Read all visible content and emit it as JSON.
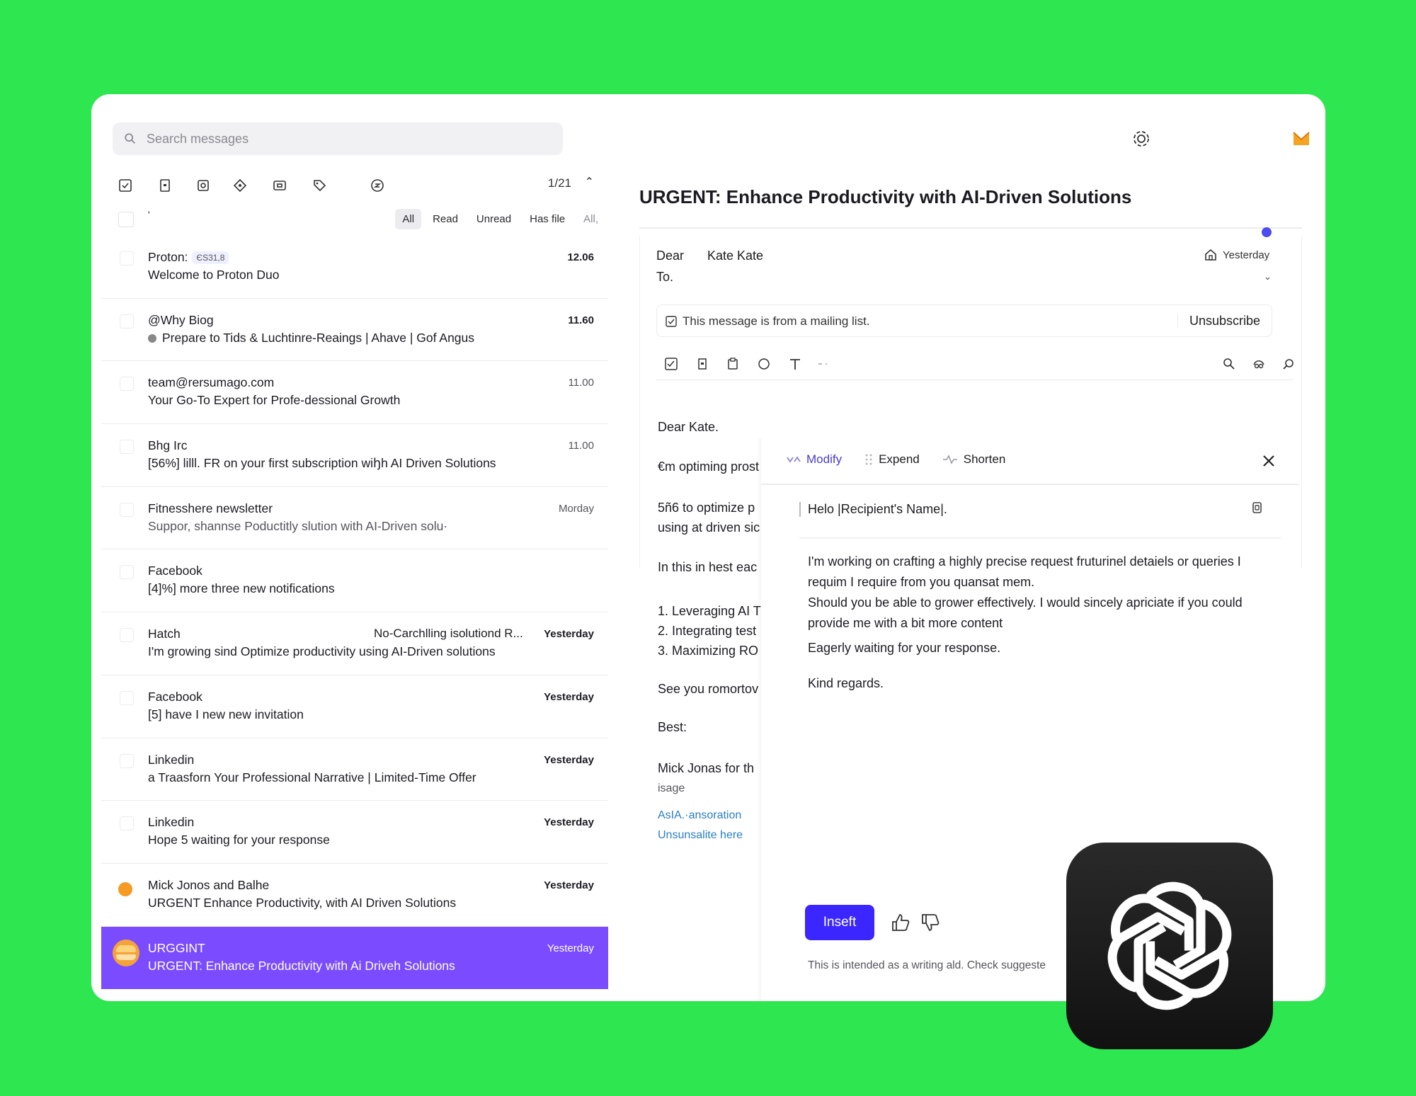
{
  "search": {
    "placeholder": "Search messages"
  },
  "toolbar": {
    "counter": "1/21",
    "chevron": "⌃"
  },
  "filters": {
    "mark": "'",
    "items": [
      "All",
      "Read",
      "Unread",
      "Has file",
      "All,"
    ]
  },
  "emails": [
    {
      "from": "Proton:",
      "tag": "ЄЅ31,8",
      "subject": "Welcome to Proton Duo",
      "time": "12.06"
    },
    {
      "from": "@Why  Biog",
      "subject": "Prepare to  Tids & Luchtinre-Reaings | Ahave | Gof Angus",
      "time": "11.60"
    },
    {
      "from": "team@rersumago.com",
      "subject": "Your Go-To Expert for Profe-dessional Growth",
      "time": "11.00"
    },
    {
      "from": "Bhg   Irc",
      "subject": "[56%] lilll. FR on your first subscription wiꜧh AI Driven Solutions",
      "time": "11.00"
    },
    {
      "from": "Fitnesshere newsletter",
      "subject": "Suppor, shannse Poductitly slution with AI-Driven solu·",
      "time": "Morday"
    },
    {
      "from": "Facebook",
      "subject": "[4]%] more three new notifications",
      "time": ""
    },
    {
      "from": "Hatch",
      "mid": "No-Carchlling isolutiond R...",
      "subject": "I'm growing sind Optimize productivity using AI-Driven solutions",
      "time": "Yesterday"
    },
    {
      "from": "Facebook",
      "subject": "[5] have I new new invitation",
      "time": "Yesterday"
    },
    {
      "from": "Linkedin",
      "subject": "a Traasforn Your Professional Narrative | Limited-Time Offer",
      "time": "Yesterday"
    },
    {
      "from": "Linkedin",
      "subject": "Hope 5 waiting for your response",
      "time": "Yesterday"
    },
    {
      "from": "Mick Jonos and Balhe",
      "subject": "URGENT  Enhance Productivity, with AI Driven Solutions",
      "time": "Yesterday"
    },
    {
      "from": "URGGINT",
      "subject": "URGENT: Enhance Productivity with Ai Driveh Solutions",
      "time": "Yesterday"
    }
  ],
  "message": {
    "title": "URGENT: Enhance Productivity with AI-Driven Solutions",
    "dear_label": "Dear",
    "recipient": "Kate Kate",
    "to_label": "To.",
    "date": "Yesterday",
    "mailing_notice": "This message is from a mailing list.",
    "unsubscribe": "Unsubscribe",
    "body": {
      "greeting": "Dear Kate.",
      "l1": "€m optiming prost",
      "l2": "5ñ6 to optimize p",
      "l3": "using at driven sic",
      "l4": "In this in hest eac",
      "l5": "1. Leveraging AI T",
      "l6": "2. Integrating test",
      "l7": "3. Maximizing RO",
      "l8": "See you romortov",
      "l9": "Best:",
      "l10": "Mick Jonas for th",
      "l11": "isage",
      "link1": "AsIA.·ansoration",
      "link2": "Unsunsalite here"
    }
  },
  "ai": {
    "tabs": [
      "Modify",
      "Expend",
      "Shorten"
    ],
    "greeting": "Helo |Recipient's Name|.",
    "p1": "I'm working on crafting a highly precise request fruturinel detaiels or queries I requim I require from you quansat mem.",
    "p2": "Should you be able to grower effectively. I would sincely apriciate if you could provide me with a bit more content",
    "p3": "Eagerly waiting for your response.",
    "p4": "Kind regards.",
    "insert_label": "Inseft",
    "disclaimer": "This is intended as a writing ald. Check suggeste"
  },
  "colors": {
    "background": "#2ee650",
    "accent": "#3b26ff",
    "selected_row": "#7b4cff"
  }
}
